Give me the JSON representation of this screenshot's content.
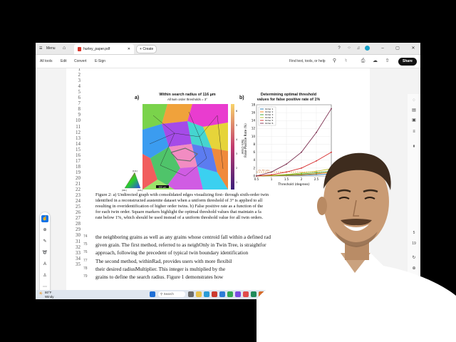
{
  "tabbar": {
    "menu_label": "Menu",
    "tab_name": "hurley_paper.pdf",
    "create_label": "Create"
  },
  "toolbar": {
    "all_tools": "All tools",
    "edit": "Edit",
    "convert": "Convert",
    "esign": "E-Sign",
    "find": "Find text, tools, or help",
    "share": "Share"
  },
  "figure": {
    "label_a": "a)",
    "label_b": "b)",
    "a_title": "Within search radius of 116 μm",
    "a_subtitle": "All twin order thresholds = 3°",
    "ipf_labels": [
      "[001]",
      "[101]",
      "[111]"
    ],
    "scalebar": "500 μm",
    "colorbar_label": "Twin Order",
    "colorbar_ticks": [
      "1",
      "2",
      "3",
      "4",
      "5",
      "6"
    ],
    "b_title_line1": "Determining optimal threshold",
    "b_title_line2": "values for false positive rate of 1%"
  },
  "chart_data": {
    "type": "line",
    "xlabel": "Threshold (degrees)",
    "ylabel": "False Positive Rate (%)",
    "xlim": [
      0.5,
      3
    ],
    "ylim": [
      0,
      18
    ],
    "xticks": [
      "0.5",
      "1",
      "1.5",
      "2",
      "2.5"
    ],
    "yticks": [
      "0",
      "2",
      "4",
      "6",
      "8",
      "10",
      "12",
      "14",
      "16",
      "18"
    ],
    "grid": true,
    "legend_placement": "top-left",
    "x": [
      0.5,
      1.0,
      1.5,
      2.0,
      2.5,
      3.0
    ],
    "series": [
      {
        "name": "Order 1",
        "color": "#1f77b4",
        "values": [
          0.0,
          0.05,
          0.1,
          0.2,
          0.35,
          0.5
        ]
      },
      {
        "name": "Order 2",
        "color": "#ff7f0e",
        "values": [
          0.0,
          0.05,
          0.15,
          0.3,
          0.55,
          0.9
        ]
      },
      {
        "name": "Order 3",
        "color": "#2ca02c",
        "values": [
          0.0,
          0.1,
          0.25,
          0.5,
          0.8,
          1.2
        ]
      },
      {
        "name": "Order 4",
        "color": "#bcbd22",
        "values": [
          0.0,
          0.15,
          0.4,
          0.75,
          1.2,
          1.8
        ]
      },
      {
        "name": "Order 5",
        "color": "#d62728",
        "values": [
          0.0,
          0.3,
          1.0,
          2.0,
          3.8,
          6.0
        ]
      },
      {
        "name": "Order 6",
        "color": "#7b2d4e",
        "values": [
          0.0,
          1.0,
          3.0,
          6.0,
          11.0,
          17.0
        ]
      }
    ],
    "annotation": "1% FP rate"
  },
  "line_numbers": [
    "1",
    "2",
    "3",
    "4",
    "5",
    "6",
    "7",
    "8",
    "9",
    "10",
    "11",
    "12",
    "13",
    "14",
    "15",
    "16",
    "17",
    "18",
    "19",
    "20",
    "21",
    "22",
    "23",
    "24",
    "25",
    "26",
    "27",
    "28",
    "29",
    "30",
    "31",
    "32",
    "33",
    "34",
    "35"
  ],
  "caption_lines": [
    "Figure 2: a) Undirected graph with consolidated edges visualizing first- through sixth-order twin",
    "identified in a reconstructed austenite dataset when a uniform threshold of 3° is applied to all",
    "resulting in overidentification of higher order twins. b) False positive rate as a function of the",
    "for each twin order. Square markers highlight the optimal threshold values that maintain a fa",
    "rate below 1%, which should be used instead of a uniform threshold value for all twin orders."
  ],
  "body_numbers": [
    "74",
    "75",
    "76",
    "77",
    "78",
    "79"
  ],
  "body_lines": [
    "the neighboring grains as well as any grains whose centroid fall within a defined rad",
    "given grain. The first method, referred to as neighOnly in Twin Tree, is straightfor",
    "approach, following the precedent of typical twin boundary identification",
    "The second method, withinRad, provides users with more flexibil",
    "their desired radiusMultiplier. This integer is multiplied by the",
    "grains to define the search radius. Figure 1 demonstrates how"
  ],
  "right_rail": [
    "5",
    "19"
  ],
  "taskbar": {
    "weather_temp": "80°F",
    "weather_cond": "Windy",
    "search_label": "Search"
  }
}
